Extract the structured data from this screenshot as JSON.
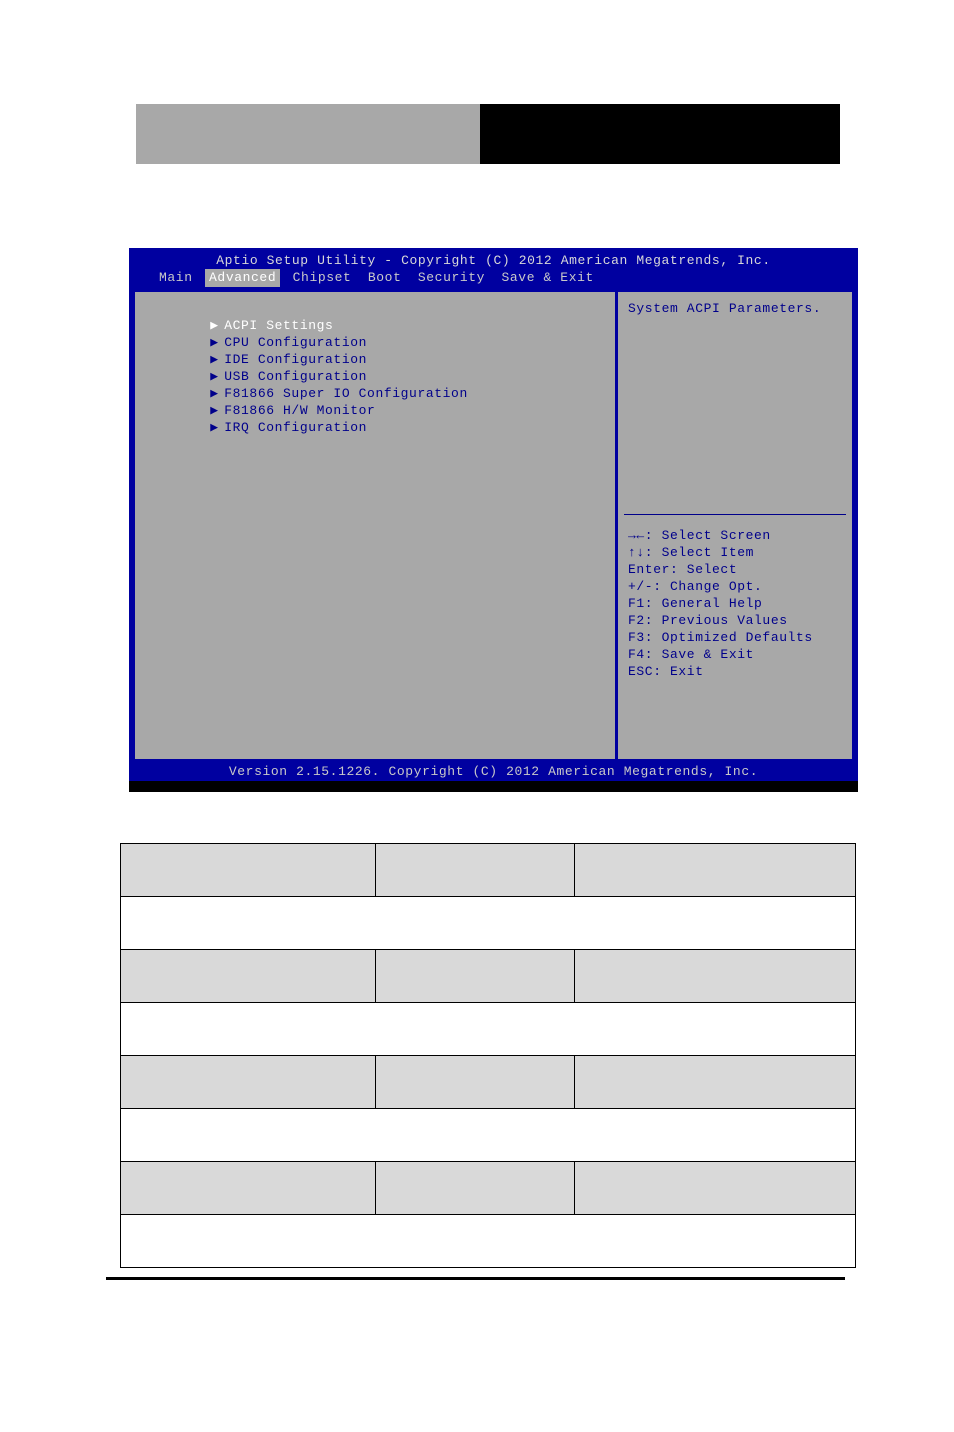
{
  "page": {
    "header_blocks": [
      {
        "name": "left-block",
        "color": "#a8a8a8"
      },
      {
        "name": "right-block",
        "color": "#000000"
      }
    ]
  },
  "bios": {
    "title": "Aptio Setup Utility - Copyright (C) 2012 American Megatrends, Inc.",
    "version_bar": "Version 2.15.1226. Copyright (C) 2012 American Megatrends, Inc.",
    "colors": {
      "background_blue": "#0000a0",
      "panel_gray": "#a8a8a8",
      "text_blue": "#00008b",
      "text_light": "#c9c9c9",
      "selected_text": "#ffffff"
    },
    "tabs": [
      {
        "label": "Main",
        "active": false
      },
      {
        "label": "Advanced",
        "active": true
      },
      {
        "label": "Chipset",
        "active": false
      },
      {
        "label": "Boot",
        "active": false
      },
      {
        "label": "Security",
        "active": false
      },
      {
        "label": "Save & Exit",
        "active": false
      }
    ],
    "menu_items": [
      {
        "arrow": "▶",
        "label": "ACPI Settings",
        "selected": true
      },
      {
        "arrow": "▶",
        "label": "CPU Configuration",
        "selected": false
      },
      {
        "arrow": "▶",
        "label": "IDE Configuration",
        "selected": false
      },
      {
        "arrow": "▶",
        "label": "USB Configuration",
        "selected": false
      },
      {
        "arrow": "▶",
        "label": "F81866 Super IO Configuration",
        "selected": false
      },
      {
        "arrow": "▶",
        "label": "F81866 H/W Monitor",
        "selected": false
      },
      {
        "arrow": "▶",
        "label": "IRQ Configuration",
        "selected": false
      }
    ],
    "help": {
      "description": "System ACPI Parameters."
    },
    "keys": [
      "→←: Select Screen",
      "↑↓: Select Item",
      "Enter: Select",
      "+/-: Change Opt.",
      "F1: General Help",
      "F2: Previous Values",
      "F3: Optimized Defaults",
      "F4: Save & Exit",
      "ESC: Exit"
    ]
  },
  "spec_table": {
    "rows": [
      {
        "type": "head",
        "cells": [
          "",
          "",
          ""
        ]
      },
      {
        "type": "desc",
        "cells": [
          ""
        ]
      },
      {
        "type": "head",
        "cells": [
          "",
          "",
          ""
        ]
      },
      {
        "type": "desc",
        "cells": [
          ""
        ]
      },
      {
        "type": "head",
        "cells": [
          "",
          "",
          ""
        ]
      },
      {
        "type": "desc",
        "cells": [
          ""
        ]
      },
      {
        "type": "head",
        "cells": [
          "",
          "",
          ""
        ]
      },
      {
        "type": "desc",
        "cells": [
          ""
        ]
      }
    ]
  }
}
